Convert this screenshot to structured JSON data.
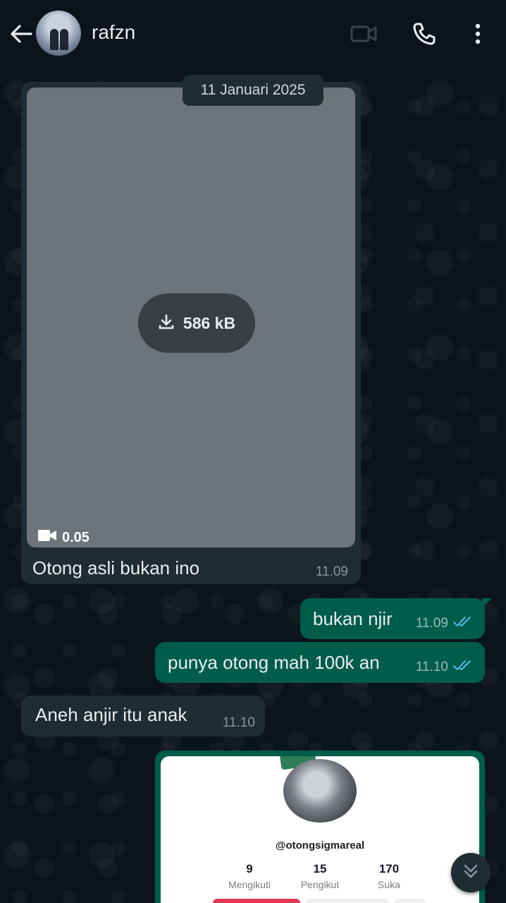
{
  "header": {
    "contact_name": "rafzn",
    "icons": [
      "back-arrow-icon",
      "video-call-icon",
      "voice-call-icon",
      "more-vert-icon"
    ]
  },
  "date_chip": "11 Januari 2025",
  "messages": [
    {
      "type": "video",
      "direction": "incoming",
      "download_size": "586 kB",
      "duration": "0.05",
      "caption": "Otong asli bukan ino",
      "time": "11.09"
    },
    {
      "type": "text",
      "direction": "outgoing",
      "text": "bukan njir",
      "time": "11.09",
      "status": "read"
    },
    {
      "type": "text",
      "direction": "outgoing",
      "text": "punya otong mah 100k an",
      "time": "11.10",
      "status": "read"
    },
    {
      "type": "text",
      "direction": "incoming",
      "text": "Aneh anjir itu anak",
      "time": "11.10"
    },
    {
      "type": "image",
      "direction": "outgoing",
      "profile": {
        "username": "@otongsigmareal",
        "stats": [
          {
            "value": "9",
            "label": "Mengikuti"
          },
          {
            "value": "15",
            "label": "Pengikut"
          },
          {
            "value": "170",
            "label": "Suka"
          }
        ]
      }
    }
  ],
  "colors": {
    "background": "#0b141a",
    "incoming_bubble": "#202c33",
    "outgoing_bubble": "#005c4b",
    "read_tick": "#53bdeb"
  }
}
